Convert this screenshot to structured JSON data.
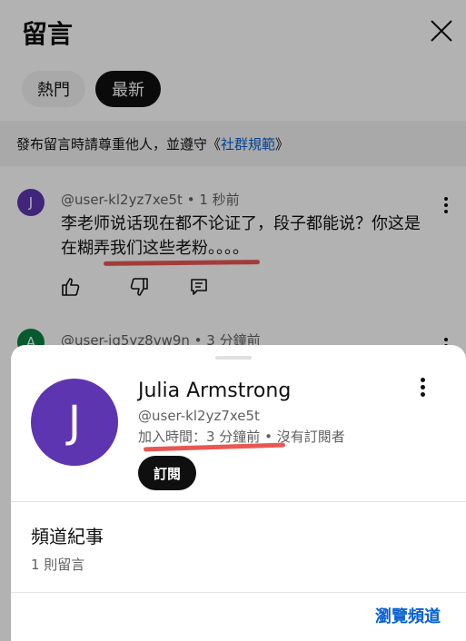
{
  "header": {
    "title": "留言",
    "close_icon": "close-icon"
  },
  "filters": [
    {
      "label": "熱門",
      "selected": false
    },
    {
      "label": "最新",
      "selected": true
    }
  ],
  "notice": {
    "prefix": "發布留言時請尊重他人，並遵守《",
    "link": "社群規範",
    "suffix": "》"
  },
  "comments": [
    {
      "avatar_letter": "J",
      "avatar_color": "#5e35b1",
      "author": "@user-kl2yz7xe5t",
      "time": "1 秒前",
      "text": "李老师说话现在都不论证了，段子都能说？你这是在糊弄我们这些老粉。。。。"
    },
    {
      "avatar_letter": "A",
      "avatar_color": "#0b8043",
      "author": "@user-ig5yz8vw9n",
      "time": "3 分鐘前"
    }
  ],
  "meta_separator": " • ",
  "profile_card": {
    "avatar_letter": "J",
    "avatar_color": "#5e35b1",
    "name": "Julia Armstrong",
    "handle": "@user-kl2yz7xe5t",
    "joined": "加入時間：3 分鐘前 • 沒有訂閱者",
    "subscribe_label": "訂閱",
    "section_title": "頻道紀事",
    "section_count": "1 則留言",
    "browse_label": "瀏覽頻道"
  },
  "colors": {
    "link": "#065fd4",
    "annotation": "#e53935"
  }
}
